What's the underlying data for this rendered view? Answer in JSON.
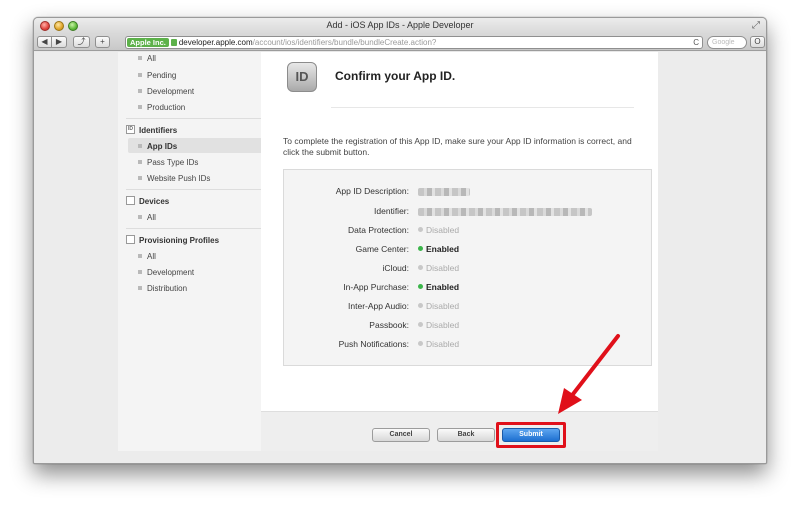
{
  "window": {
    "title": "Add - iOS App IDs - Apple Developer"
  },
  "toolbar": {
    "back_label": "◀",
    "forward_label": "▶",
    "share_label": "⤴",
    "add_label": "+",
    "ev_badge": "Apple Inc.",
    "url_domain": "developer.apple.com",
    "url_path": "/account/ios/identifiers/bundle/bundleCreate.action?",
    "search_placeholder": "Google",
    "reload_label": "C",
    "reader_label": "O"
  },
  "sidebar": {
    "certificates_items": [
      "All",
      "Pending",
      "Development",
      "Production"
    ],
    "identifiers_heading": "Identifiers",
    "identifiers_icon": "ID",
    "identifiers_items": [
      "App IDs",
      "Pass Type IDs",
      "Website Push IDs"
    ],
    "devices_heading": "Devices",
    "devices_items": [
      "All"
    ],
    "profiles_heading": "Provisioning Profiles",
    "profiles_items": [
      "All",
      "Development",
      "Distribution"
    ]
  },
  "main": {
    "icon_text": "ID",
    "title": "Confirm your App ID.",
    "instructions": "To complete the registration of this App ID, make sure your App ID information is correct, and click the submit button.",
    "rows": [
      {
        "label": "App ID Description:",
        "status": "blurred",
        "value": ""
      },
      {
        "label": "Identifier:",
        "status": "blurred",
        "value": ""
      },
      {
        "label": "Data Protection:",
        "status": "disabled",
        "value": "Disabled"
      },
      {
        "label": "Game Center:",
        "status": "enabled",
        "value": "Enabled"
      },
      {
        "label": "iCloud:",
        "status": "disabled",
        "value": "Disabled"
      },
      {
        "label": "In-App Purchase:",
        "status": "enabled",
        "value": "Enabled"
      },
      {
        "label": "Inter-App Audio:",
        "status": "disabled",
        "value": "Disabled"
      },
      {
        "label": "Passbook:",
        "status": "disabled",
        "value": "Disabled"
      },
      {
        "label": "Push Notifications:",
        "status": "disabled",
        "value": "Disabled"
      }
    ]
  },
  "footer": {
    "cancel_label": "Cancel",
    "back_label": "Back",
    "submit_label": "Submit"
  },
  "colors": {
    "enabled_dot": "#3bb54a",
    "disabled_dot": "#c8c8c8",
    "submit_button": "#1d6fd0",
    "annotation_red": "#e0101a"
  }
}
